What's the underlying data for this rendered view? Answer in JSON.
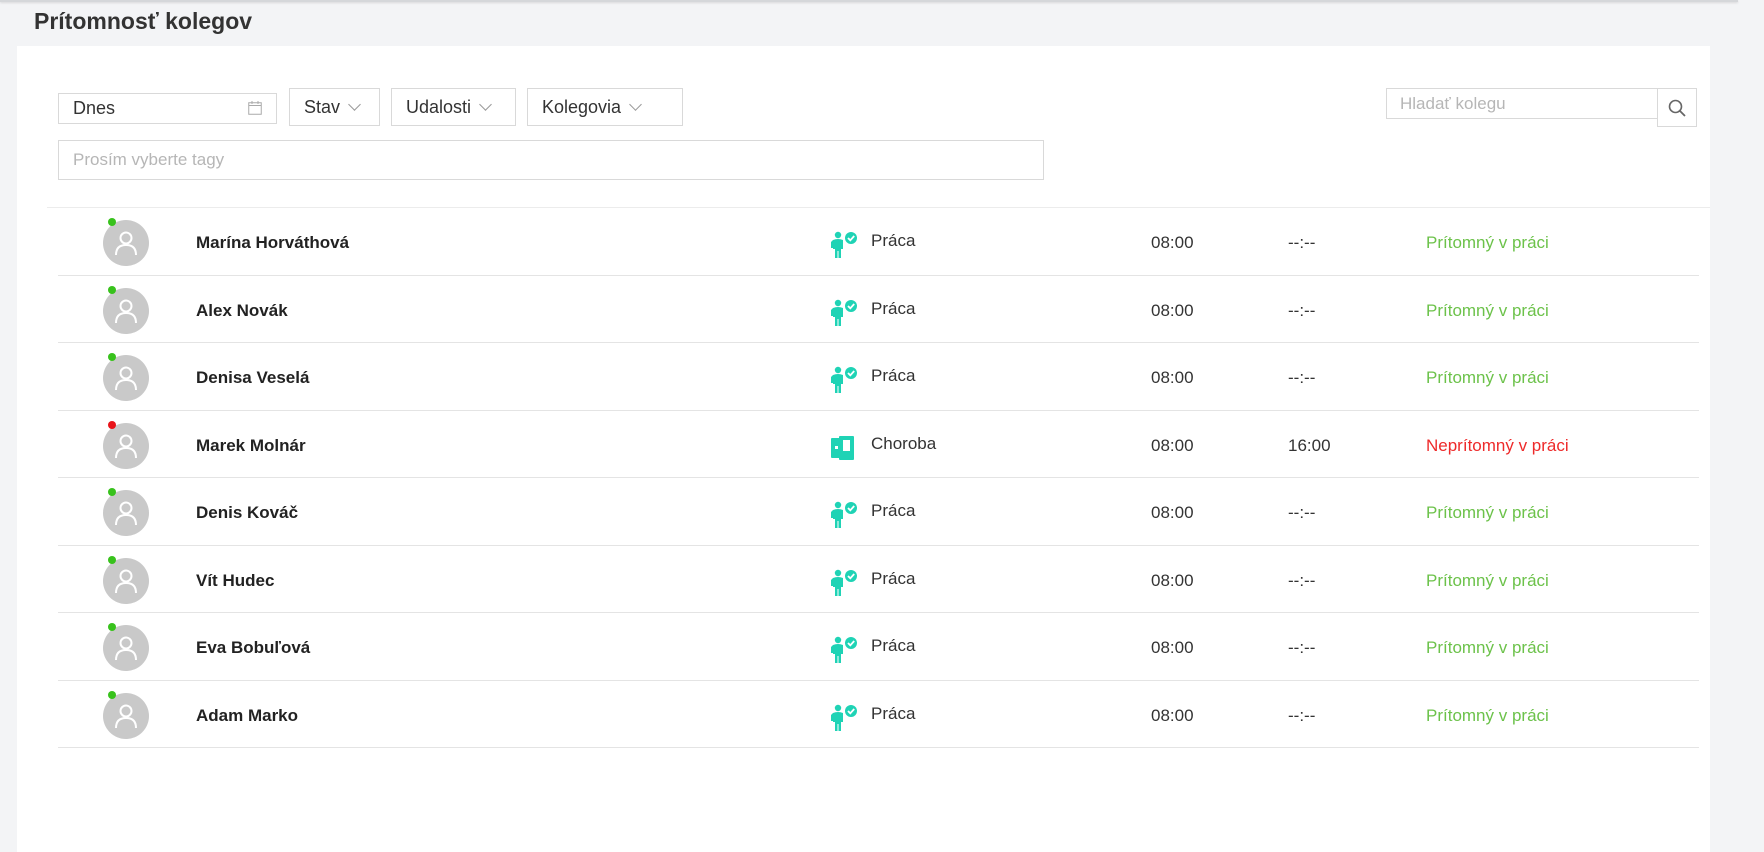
{
  "page": {
    "title": "Prítomnosť kolegov"
  },
  "filters": {
    "date_value": "Dnes",
    "state_label": "Stav",
    "events_label": "Udalosti",
    "colleagues_label": "Kolegovia",
    "tags_placeholder": "Prosím vyberte tagy",
    "search_placeholder": "Hladať kolegu"
  },
  "colors": {
    "accent": "#1fd3b5",
    "present": "#6cc24a",
    "absent": "#ee2a2a",
    "online_dot": "#38c21c",
    "offline_dot": "#e8141a"
  },
  "rows": [
    {
      "name": "Marína Horváthová",
      "event": "Práca",
      "event_icon": "work-person-icon",
      "time_in": "08:00",
      "time_out": "--:--",
      "status": "Prítomný v práci",
      "present": true
    },
    {
      "name": "Alex Novák",
      "event": "Práca",
      "event_icon": "work-person-icon",
      "time_in": "08:00",
      "time_out": "--:--",
      "status": "Prítomný v práci",
      "present": true
    },
    {
      "name": "Denisa Veselá",
      "event": "Práca",
      "event_icon": "work-person-icon",
      "time_in": "08:00",
      "time_out": "--:--",
      "status": "Prítomný v práci",
      "present": true
    },
    {
      "name": "Marek Molnár",
      "event": "Choroba",
      "event_icon": "sick-leave-icon",
      "time_in": "08:00",
      "time_out": "16:00",
      "status": "Neprítomný v práci",
      "present": false
    },
    {
      "name": "Denis Kováč",
      "event": "Práca",
      "event_icon": "work-person-icon",
      "time_in": "08:00",
      "time_out": "--:--",
      "status": "Prítomný v práci",
      "present": true
    },
    {
      "name": "Vít Hudec",
      "event": "Práca",
      "event_icon": "work-person-icon",
      "time_in": "08:00",
      "time_out": "--:--",
      "status": "Prítomný v práci",
      "present": true
    },
    {
      "name": "Eva Bobuľová",
      "event": "Práca",
      "event_icon": "work-person-icon",
      "time_in": "08:00",
      "time_out": "--:--",
      "status": "Prítomný v práci",
      "present": true
    },
    {
      "name": "Adam Marko",
      "event": "Práca",
      "event_icon": "work-person-icon",
      "time_in": "08:00",
      "time_out": "--:--",
      "status": "Prítomný v práci",
      "present": true
    }
  ]
}
